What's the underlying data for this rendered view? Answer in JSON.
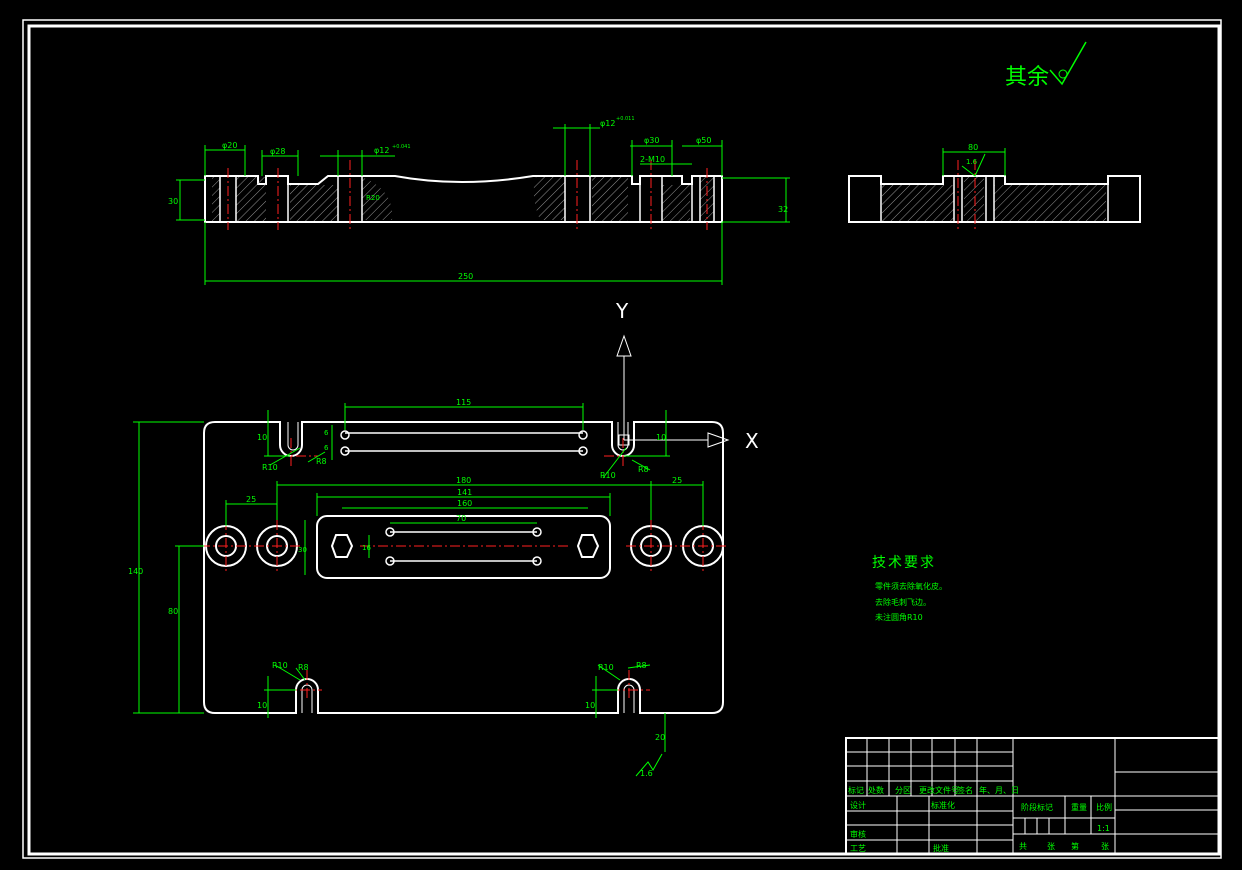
{
  "drawing": {
    "surface_note": "其余",
    "surface_symbol": "roughness-symbol",
    "axis_x": "X",
    "axis_y": "Y",
    "roughness_value": "1.6",
    "front_view_dims": {
      "d20": "φ20",
      "d28": "φ28",
      "d12a": "φ12",
      "d12b": "φ12",
      "d30": "φ30",
      "d50": "φ50",
      "tol_a": "+0.041",
      "tol_b": "+0.011",
      "thread": "2-M10",
      "h30": "30",
      "h32": "32",
      "w250": "250",
      "r20": "R20"
    },
    "side_view_dims": {
      "w80": "80",
      "rough": "1.6"
    },
    "plan_dims": {
      "d115": "115",
      "d180": "180",
      "d141": "141",
      "d160": "160",
      "d70": "70",
      "d25l": "25",
      "d25r": "25",
      "h140": "140",
      "h80": "80",
      "h10a": "10",
      "h10b": "10",
      "h10c": "10",
      "h10d": "10",
      "h20": "20",
      "r10a": "R10",
      "r10b": "R10",
      "r10c": "R10",
      "r10d": "R10",
      "r8a": "R8",
      "r8b": "R8",
      "r8c": "R8",
      "r8d": "R8",
      "d6a": "6",
      "d6b": "6",
      "d16": "16",
      "d30": "30"
    },
    "tech_title": "技术要求",
    "tech_notes": [
      "零件须去除氧化皮。",
      "去除毛刺飞边。",
      "未注圆角R10"
    ]
  },
  "title_block": {
    "row_labels": [
      "标记",
      "处数",
      "分区",
      "更改文件号",
      "签名",
      "年、月、日"
    ],
    "design": "设计",
    "standardize": "标准化",
    "review": "审核",
    "process": "工艺",
    "approve": "批准",
    "stage_mark": "阶段标记",
    "weight": "重量",
    "scale": "比例",
    "scale_value": "1:1",
    "total": "共",
    "sheets": "张",
    "page": "第",
    "sheet2": "张"
  }
}
